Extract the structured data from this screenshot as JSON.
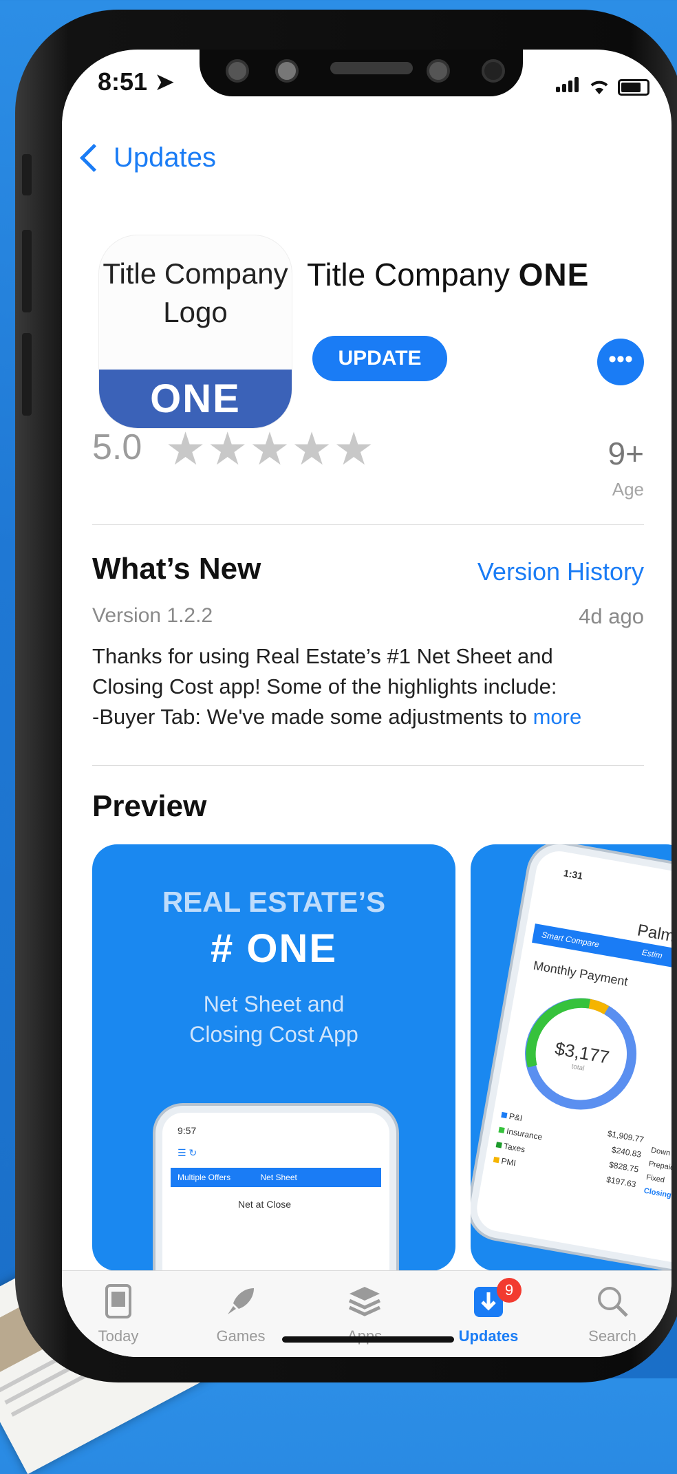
{
  "status": {
    "time": "8:51"
  },
  "nav": {
    "back_label": "Updates"
  },
  "app": {
    "icon_text": "Title Company Logo",
    "icon_brand": "ONE",
    "name": "Title Company",
    "name_brand": "ONE",
    "update_label": "UPDATE",
    "more_label": "•••",
    "rating": "5.0",
    "stars": 5,
    "age_value": "9+",
    "age_label": "Age"
  },
  "whats_new": {
    "title": "What’s New",
    "history_link": "Version History",
    "version": "Version 1.2.2",
    "date": "4d ago",
    "line1": "Thanks for using Real Estate’s #1 Net Sheet and",
    "line2": "Closing Cost app! Some of the highlights include:",
    "line3": "-Buyer Tab: We've made some adjustments to",
    "more_link": "more"
  },
  "preview": {
    "title": "Preview",
    "card1": {
      "headline": "REAL ESTATE’S",
      "brand": "# ONE",
      "subtitle_line1": "Net Sheet and",
      "subtitle_line2": "Closing Cost App",
      "mini_time": "9:57",
      "mini_tab_a": "Multiple Offers",
      "mini_tab_b": "Net Sheet",
      "mini_label": "Net at Close"
    },
    "card2": {
      "mini_time": "1:31",
      "app_label": "PalmAg",
      "tab_a": "Smart Compare",
      "tab_b": "Estim",
      "section": "Monthly Payment",
      "amount": "$3,177",
      "amount_sub": "total",
      "legend": [
        {
          "label": "P&I",
          "value": "$1,909.77",
          "color": "#1a7cf5"
        },
        {
          "label": "Insurance",
          "value": "$240.83",
          "color": "#36c23c"
        },
        {
          "label": "Taxes",
          "value": "$828.75",
          "color": "#1d9b2b"
        },
        {
          "label": "PMI",
          "value": "$197.63",
          "color": "#f5b400"
        }
      ],
      "legend2": [
        "Down",
        "Prepaid",
        "Fixed"
      ],
      "closing_link": "Closing"
    }
  },
  "tabbar": {
    "items": [
      {
        "label": "Today",
        "icon": "today-icon"
      },
      {
        "label": "Games",
        "icon": "rocket-icon"
      },
      {
        "label": "Apps",
        "icon": "layers-icon"
      },
      {
        "label": "Updates",
        "icon": "download-icon",
        "badge": "9",
        "active": true
      },
      {
        "label": "Search",
        "icon": "search-icon"
      }
    ]
  },
  "colors": {
    "accent": "#1a7cf5",
    "brand_band": "#3b62b8",
    "badge": "#f23b30"
  }
}
